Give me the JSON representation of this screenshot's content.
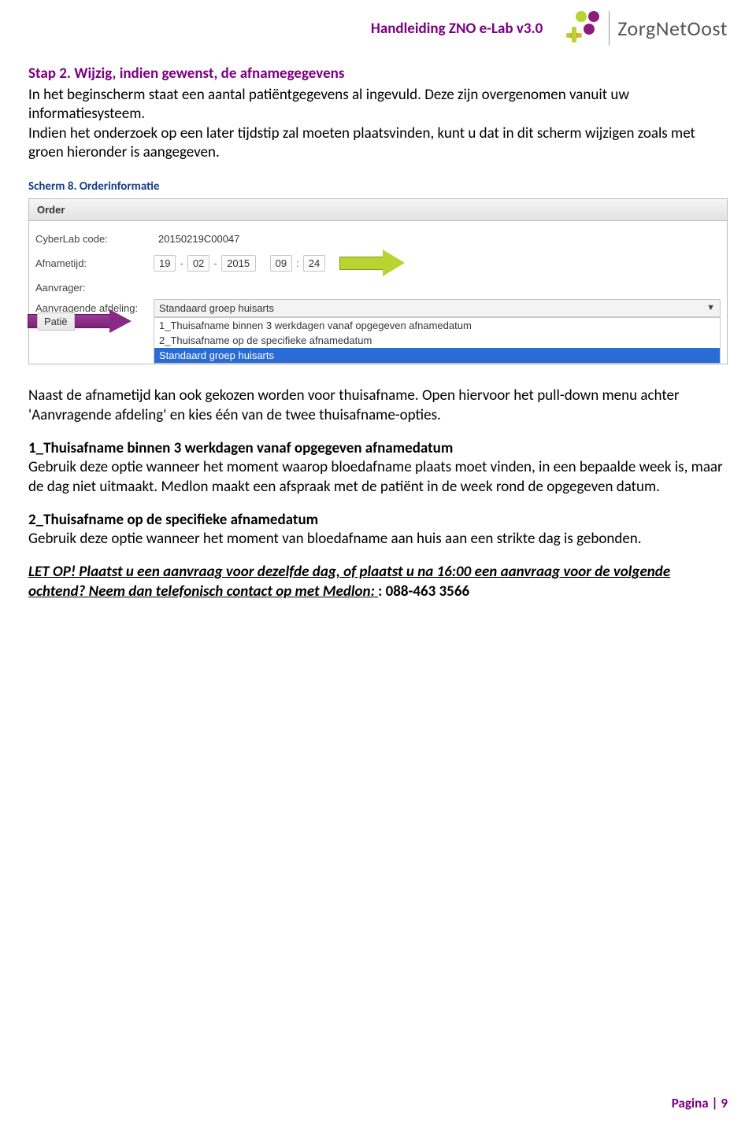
{
  "header": {
    "title": "Handleiding ZNO e-Lab v3.0",
    "brand": "ZorgNetOost"
  },
  "step": {
    "heading": "Stap 2. Wijzig, indien gewenst, de afnamegegevens",
    "p1": "In het beginscherm staat een aantal patiëntgegevens al ingevuld. Deze zijn overgenomen vanuit uw informatiesysteem.",
    "p2": "Indien het onderzoek op een later tijdstip zal moeten plaatsvinden, kunt u dat in dit scherm wijzigen zoals met groen hieronder is aangegeven."
  },
  "caption": "Scherm 8. Orderinformatie",
  "screenshot": {
    "order_bar": "Order",
    "labels": {
      "cyberlab": "CyberLab code:",
      "afnametijd": "Afnametijd:",
      "aanvrager": "Aanvrager:",
      "aanvragende": "Aanvragende afdeling:",
      "patie": "Patië"
    },
    "cyberlab_value": "20150219C00047",
    "date": {
      "d": "19",
      "m": "02",
      "y": "2015"
    },
    "time": {
      "h": "09",
      "min": "24"
    },
    "select_value": "Standaard groep huisarts",
    "options": [
      "1_Thuisafname binnen 3 werkdagen vanaf opgegeven afnamedatum",
      "2_Thuisafname op de specifieke afnamedatum",
      "Standaard groep huisarts"
    ]
  },
  "body": {
    "p3": "Naast de afnametijd kan ook gekozen worden voor thuisafname. Open hiervoor het pull-down menu achter 'Aanvragende afdeling' en kies één van de twee thuisafname-opties.",
    "h1": "1_Thuisafname binnen 3 werkdagen vanaf opgegeven afnamedatum",
    "p4": "Gebruik deze optie wanneer het moment waarop bloedafname plaats moet vinden, in een bepaalde week is, maar de dag niet uitmaakt. Medlon maakt een afspraak met de patiënt in de week rond de opgegeven datum.",
    "h2": "2_Thuisafname op de specifieke afnamedatum",
    "p5": "Gebruik deze optie wanneer het moment van bloedafname aan huis  aan een strikte dag is gebonden.",
    "letop1": "LET OP! Plaatst u een aanvraag voor dezelfde dag, of plaatst u na 16:00 een aanvraag voor de volgende ochtend? Neem dan telefonisch contact op met Medlon: ",
    "letop2": ": 088-463 3566"
  },
  "footer": "Pagina | 9"
}
